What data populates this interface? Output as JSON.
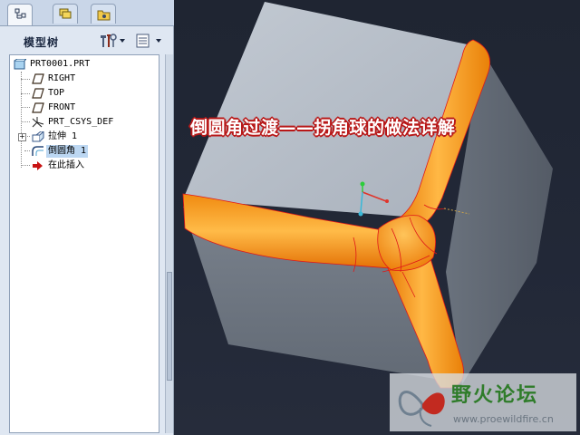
{
  "tabs": [
    {
      "name": "model-tree-tab"
    },
    {
      "name": "layers-tab"
    },
    {
      "name": "folder-tab"
    }
  ],
  "tree_header": {
    "title": "模型树"
  },
  "tree": {
    "items": [
      {
        "label": "PRT0001.PRT",
        "icon": "part-icon"
      },
      {
        "label": "RIGHT",
        "icon": "datum-plane-icon"
      },
      {
        "label": "TOP",
        "icon": "datum-plane-icon"
      },
      {
        "label": "FRONT",
        "icon": "datum-plane-icon"
      },
      {
        "label": "PRT_CSYS_DEF",
        "icon": "csys-icon"
      },
      {
        "label": "拉伸 1",
        "icon": "extrude-icon"
      },
      {
        "label": "倒圆角 1",
        "icon": "round-icon"
      },
      {
        "label": "在此插入",
        "icon": "insert-arrow-icon"
      }
    ]
  },
  "overlay": {
    "title": "倒圆角过渡——拐角球的做法详解"
  },
  "watermark": {
    "site_name": "野火论坛",
    "url": "www.proewildfire.cn"
  },
  "colors": {
    "cube_top": "#b4bcc7",
    "cube_left": "#6e7682",
    "cube_right": "#5c646f",
    "round_orange": "#ff9a1a",
    "edge_red": "#e01818",
    "viewport_bg": "#1f2532",
    "panel_bg": "#dfe7f2"
  }
}
